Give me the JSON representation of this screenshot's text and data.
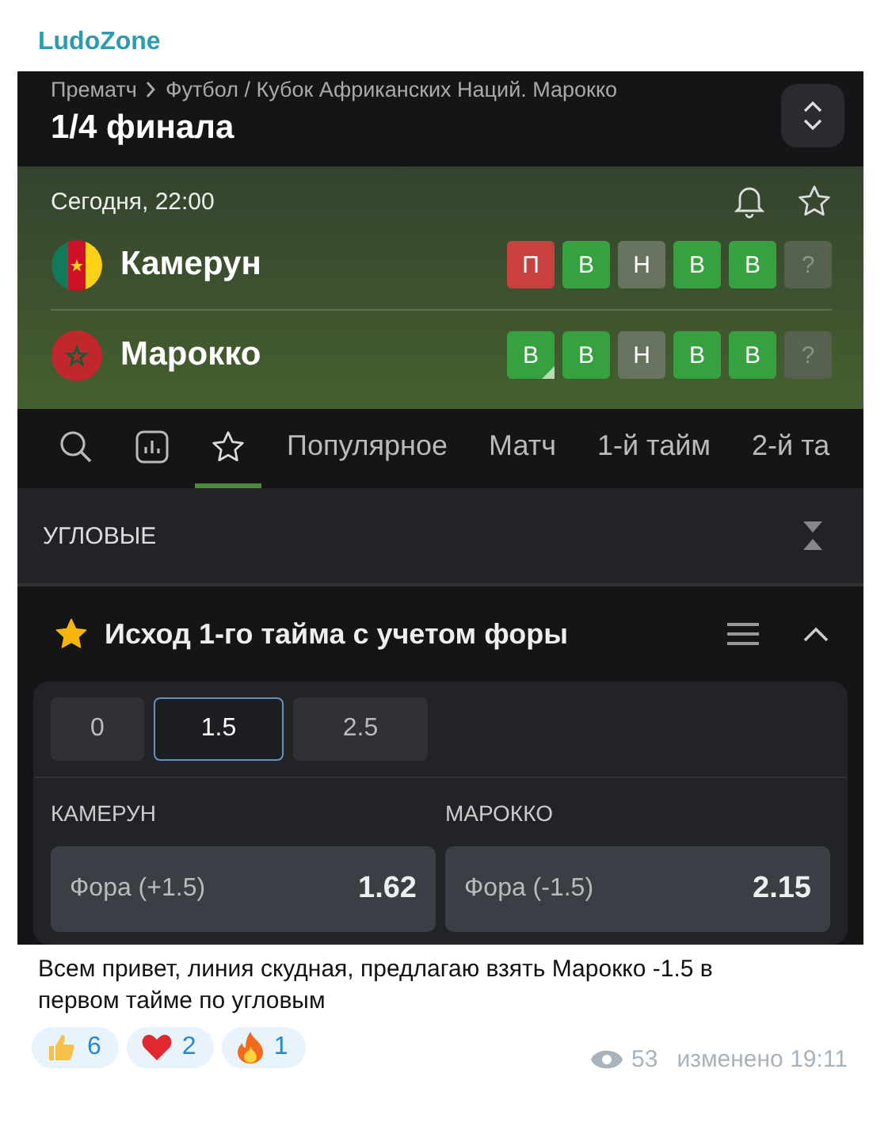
{
  "channel": {
    "name": "LudoZone"
  },
  "header": {
    "breadcrumb": [
      "Прематч",
      "Футбол / Кубок Африканских Наций. Марокко"
    ],
    "title": "1/4 финала"
  },
  "match": {
    "time": "Сегодня, 22:00",
    "teams": [
      {
        "name": "Камерун",
        "flag": {
          "kind": "cameroon"
        },
        "form": [
          {
            "label": "П",
            "kind": "loss",
            "flagged": false
          },
          {
            "label": "В",
            "kind": "win",
            "flagged": false
          },
          {
            "label": "Н",
            "kind": "draw",
            "flagged": false
          },
          {
            "label": "В",
            "kind": "win",
            "flagged": false
          },
          {
            "label": "В",
            "kind": "win",
            "flagged": false
          },
          {
            "label": "?",
            "kind": "unknown",
            "flagged": false
          }
        ]
      },
      {
        "name": "Марокко",
        "flag": {
          "kind": "morocco"
        },
        "form": [
          {
            "label": "В",
            "kind": "win",
            "flagged": true
          },
          {
            "label": "В",
            "kind": "win",
            "flagged": false
          },
          {
            "label": "Н",
            "kind": "draw",
            "flagged": false
          },
          {
            "label": "В",
            "kind": "win",
            "flagged": false
          },
          {
            "label": "В",
            "kind": "win",
            "flagged": false
          },
          {
            "label": "?",
            "kind": "unknown",
            "flagged": false
          }
        ]
      }
    ]
  },
  "tabs": [
    {
      "kind": "search",
      "selected": false
    },
    {
      "kind": "stats",
      "selected": false
    },
    {
      "kind": "favorites",
      "selected": true
    },
    {
      "kind": "text",
      "label": "Популярное",
      "selected": false
    },
    {
      "kind": "text",
      "label": "Матч",
      "selected": false
    },
    {
      "kind": "text",
      "label": "1-й тайм",
      "selected": false
    },
    {
      "kind": "text",
      "label": "2-й та",
      "selected": false
    }
  ],
  "section": {
    "title": "УГЛОВЫЕ"
  },
  "market": {
    "title": "Исход 1-го тайма с учетом форы",
    "favorite": true,
    "expanded": true,
    "lines": [
      {
        "label": "0",
        "selected": false
      },
      {
        "label": "1.5",
        "selected": true
      },
      {
        "label": "2.5",
        "selected": false
      }
    ],
    "columns": [
      {
        "team": "КАМЕРУН",
        "bet": "Фора (+1.5)",
        "odds": "1.62"
      },
      {
        "team": "МАРОККО",
        "bet": "Фора (-1.5)",
        "odds": "2.15"
      }
    ]
  },
  "message": {
    "text": "Всем привет, линия скудная, предлагаю взять Марокко -1.5 в первом тайме по угловым",
    "reactions": [
      {
        "kind": "thumbs",
        "count": "6"
      },
      {
        "kind": "heart",
        "count": "2"
      },
      {
        "kind": "fire",
        "count": "1"
      }
    ],
    "views": "53",
    "edited": "изменено 19:11"
  }
}
